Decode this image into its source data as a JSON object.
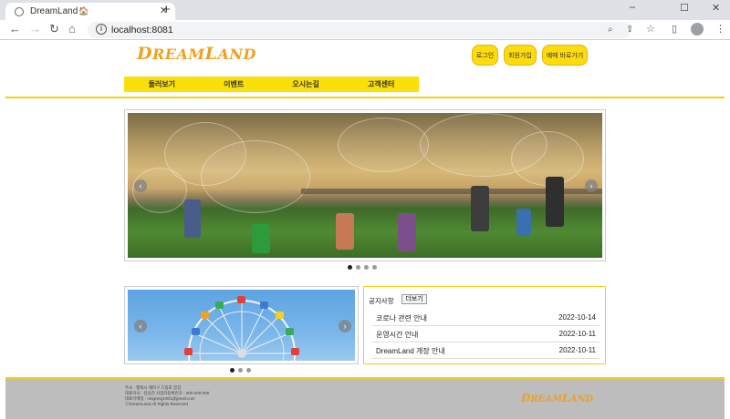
{
  "browser": {
    "tab_title": "DreamLand",
    "url": "localhost:8081",
    "win_min": "–",
    "win_max": "☐",
    "win_close": "✕",
    "back": "←",
    "forward": "→",
    "reload": "↻",
    "home": "⌂",
    "new_tab": "+",
    "tab_close": "✕",
    "zoom_icon": "⌕",
    "share_icon": "⇪",
    "star_icon": "☆",
    "sidebar_icon": "▯",
    "menu_icon": "⋮",
    "info_icon": "i",
    "house_icon": "🏠"
  },
  "header": {
    "logo_big1": "D",
    "logo_rest1": "REAM",
    "logo_big2": "L",
    "logo_rest2": "AND",
    "login": "로그인",
    "signup": "회원가입",
    "reserve": "예매 바로가기"
  },
  "nav": {
    "items": [
      "둘러보기",
      "이벤트",
      "오시는길",
      "고객센터"
    ]
  },
  "hero": {
    "prev": "‹",
    "next": "›",
    "slide_count": 4,
    "active": 0
  },
  "ferris": {
    "prev": "‹",
    "next": "›",
    "slide_count": 3,
    "active": 0
  },
  "notice": {
    "title": "공지사항",
    "more": "더보기",
    "items": [
      {
        "title": "코로나 관련 안내",
        "date": "2022-10-14"
      },
      {
        "title": "운영시간 안내",
        "date": "2022-10-11"
      },
      {
        "title": "DreamLand 개장 안내",
        "date": "2022-10-11"
      }
    ]
  },
  "footer": {
    "lines": [
      "주소 : 행복시 해피구 드림로 꿈길",
      "대표이사 : 김승진  사업자등록번호 : 000-000-000",
      "대표이메일 : ningning1001@gmail.com",
      "ⓒDreamLand.All Rights Reserved"
    ],
    "logo_big1": "D",
    "logo_rest1": "REAM",
    "logo_big2": "L",
    "logo_rest2": "AND"
  },
  "colors": {
    "accent_yellow": "#fadf0b",
    "logo_orange": "#f0a020",
    "footer_gray": "#bdbdbd"
  }
}
